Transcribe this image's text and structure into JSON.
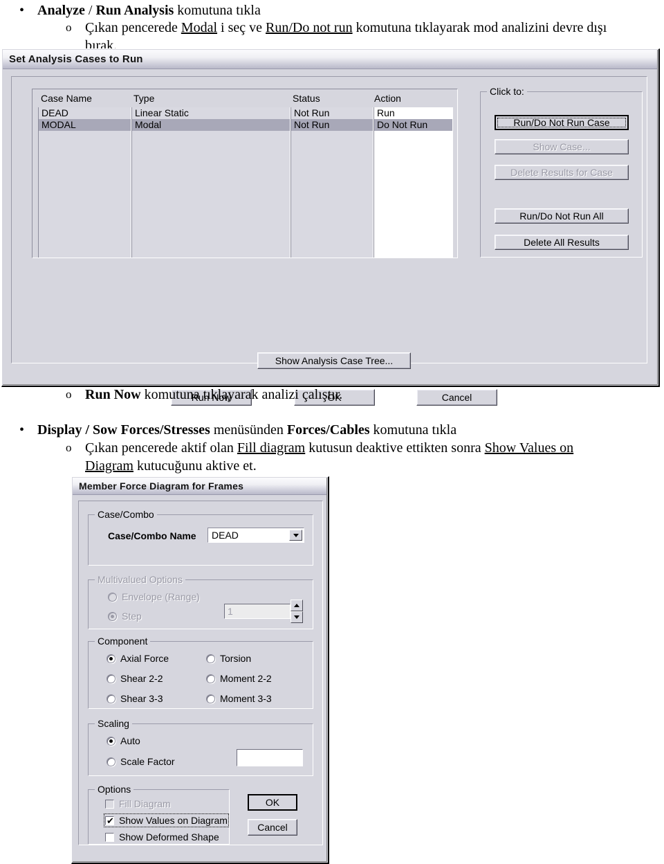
{
  "document": {
    "line1": {
      "marker": "•",
      "parts": [
        "Analyze",
        " / ",
        "Run Analysis",
        " komutuna tıkla"
      ]
    },
    "line2": {
      "marker": "o",
      "text_a": "Çıkan pencerede ",
      "link_a": "Modal",
      "text_b": " i seç ve ",
      "link_b": "Run/Do not run",
      "text_c": " komutuna tıklayarak mod analizini devre dışı",
      "text_d": "bırak."
    },
    "line3": {
      "marker": "o",
      "bold": "Run Now",
      "text": " komutuna tıklayarak analizi çalıştır."
    },
    "line4": {
      "marker": "•",
      "bold_a": "Display / Sow Forces/Stresses",
      "text_a": " menüsünden ",
      "bold_b": "Forces/Cables",
      "text_b": " komutuna tıkla"
    },
    "line5": {
      "marker": "o",
      "text_a": "Çıkan pencerede aktif olan ",
      "link_a": "Fill diagram",
      "text_b": " kutusun deaktive ettikten sonra ",
      "link_b": "Show Values on",
      "link_c": "Diagram",
      "text_c": " kutucuğunu aktive et."
    }
  },
  "dialog1": {
    "title": "Set Analysis Cases to Run",
    "table": {
      "headers": [
        "Case Name",
        "Type",
        "Status",
        "Action"
      ],
      "rows": [
        {
          "case_name": "DEAD",
          "type": "Linear Static",
          "status": "Not Run",
          "action": "Run",
          "selected": false
        },
        {
          "case_name": "MODAL",
          "type": "Modal",
          "status": "Not Run",
          "action": "Do Not Run",
          "selected": true
        }
      ]
    },
    "click_to": {
      "label": "Click to:",
      "buttons": [
        {
          "label": "Run/Do Not Run Case",
          "state": "default"
        },
        {
          "label": "Show Case...",
          "state": "disabled"
        },
        {
          "label": "Delete Results for Case",
          "state": "disabled"
        },
        {
          "label": "Run/Do Not Run All",
          "state": "normal"
        },
        {
          "label": "Delete All Results",
          "state": "normal"
        }
      ]
    },
    "tree_button": "Show Analysis Case Tree...",
    "footer_buttons": [
      "Run Now",
      "OK",
      "Cancel"
    ]
  },
  "dialog2": {
    "title": "Member Force Diagram for Frames",
    "case_combo": {
      "group_label": "Case/Combo",
      "field_label": "Case/Combo Name",
      "value": "DEAD"
    },
    "multivalued": {
      "group_label": "Multivalued Options",
      "envelope_label": "Envelope (Range)",
      "step_label": "Step",
      "step_value": "1",
      "selected": "Step",
      "disabled": true
    },
    "component": {
      "group_label": "Component",
      "options": [
        {
          "label": "Axial Force",
          "selected": true
        },
        {
          "label": "Torsion",
          "selected": false
        },
        {
          "label": "Shear 2-2",
          "selected": false
        },
        {
          "label": "Moment 2-2",
          "selected": false
        },
        {
          "label": "Shear 3-3",
          "selected": false
        },
        {
          "label": "Moment 3-3",
          "selected": false
        }
      ]
    },
    "scaling": {
      "group_label": "Scaling",
      "auto_label": "Auto",
      "scale_factor_label": "Scale Factor",
      "scale_factor_value": "",
      "selected": "Auto"
    },
    "options": {
      "group_label": "Options",
      "items": [
        {
          "label": "Fill Diagram",
          "checked": false,
          "disabled": true,
          "focused": false
        },
        {
          "label": "Show Values on Diagram",
          "checked": true,
          "disabled": false,
          "focused": true
        },
        {
          "label": "Show Deformed Shape",
          "checked": false,
          "disabled": false,
          "focused": false
        }
      ]
    },
    "ok_label": "OK",
    "cancel_label": "Cancel"
  },
  "colors": {
    "dialog_face": "#d6d6de",
    "selection": "#a8a8b8",
    "disabled_text": "#9a9aa6",
    "field_white": "#ffffff",
    "border_dark": "#8d8d9c"
  }
}
